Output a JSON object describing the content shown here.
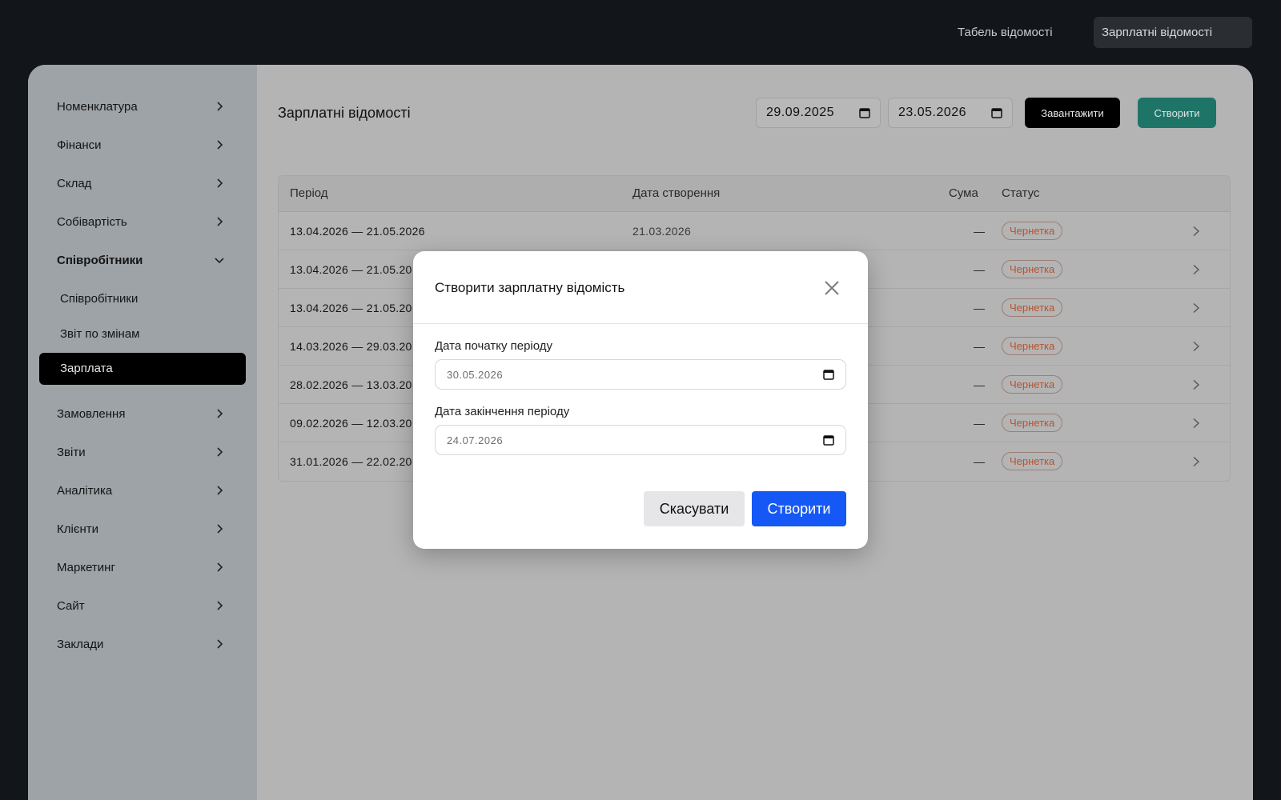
{
  "topnav": {
    "tabs": [
      {
        "label": "Табель відомості"
      },
      {
        "label": "Зарплатні відомості"
      }
    ]
  },
  "sidebar": {
    "items": [
      {
        "label": "Номенклатура"
      },
      {
        "label": "Фінанси"
      },
      {
        "label": "Склад"
      },
      {
        "label": "Собівартість"
      },
      {
        "label": "Співробітники"
      },
      {
        "label": "Замовлення"
      },
      {
        "label": "Звіти"
      },
      {
        "label": "Аналітика"
      },
      {
        "label": "Клієнти"
      },
      {
        "label": "Маркетинг"
      },
      {
        "label": "Сайт"
      },
      {
        "label": "Заклади"
      }
    ],
    "subitems": [
      {
        "label": "Співробітники"
      },
      {
        "label": "Звіт по змінам"
      },
      {
        "label": "Зарплата"
      }
    ]
  },
  "main": {
    "title": "Зарплатні відомості",
    "date_from": "29.09.2025",
    "date_to": "23.05.2026",
    "load_label": "Завантажити",
    "create_label": "Створити"
  },
  "table": {
    "headers": {
      "period": "Період",
      "created": "Дата створення",
      "sum": "Сума",
      "status": "Статус"
    },
    "rows": [
      {
        "period": "13.04.2026 — 21.05.2026",
        "created": "21.03.2026",
        "sum": "—",
        "status": "Чернетка"
      },
      {
        "period": "13.04.2026 — 21.05.20",
        "created": "",
        "sum": "—",
        "status": "Чернетка"
      },
      {
        "period": "13.04.2026 — 21.05.20",
        "created": "",
        "sum": "—",
        "status": "Чернетка"
      },
      {
        "period": "14.03.2026 — 29.03.20",
        "created": "",
        "sum": "—",
        "status": "Чернетка"
      },
      {
        "period": "28.02.2026 — 13.03.20",
        "created": "",
        "sum": "—",
        "status": "Чернетка"
      },
      {
        "period": "09.02.2026 — 12.03.20",
        "created": "",
        "sum": "—",
        "status": "Чернетка"
      },
      {
        "period": "31.01.2026 — 22.02.20",
        "created": "",
        "sum": "—",
        "status": "Чернетка"
      }
    ]
  },
  "modal": {
    "title": "Створити зарплатну відомість",
    "start_label": "Дата початку періоду",
    "start_value": "30.05.2026",
    "end_label": "Дата закінчення періоду",
    "end_value": "24.07.2026",
    "cancel_label": "Скасувати",
    "submit_label": "Створити"
  }
}
